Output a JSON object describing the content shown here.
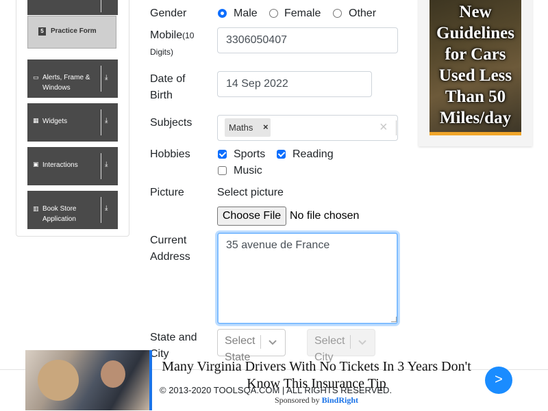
{
  "sidebar": {
    "groups": [
      {
        "label": "Alerts, Frame & Windows",
        "icon": "window-icon"
      },
      {
        "label": "Widgets",
        "icon": "widgets-icon"
      },
      {
        "label": "Interactions",
        "icon": "interactions-icon"
      },
      {
        "label": "Book Store Application",
        "icon": "bookstore-icon"
      }
    ],
    "active_subitem": {
      "label": "Practice Form",
      "icon": "html5-icon"
    },
    "arrow_glyph": "⤓"
  },
  "form": {
    "gender": {
      "label": "Gender",
      "options": [
        "Male",
        "Female",
        "Other"
      ],
      "selected": "Male"
    },
    "mobile": {
      "label": "Mobile",
      "hint": "(10 Digits)",
      "value": "3306050407"
    },
    "dob": {
      "label": "Date of Birth",
      "value": "14 Sep 2022"
    },
    "subjects": {
      "label": "Subjects",
      "chips": [
        "Maths"
      ],
      "clear_glyph": "×"
    },
    "hobbies": {
      "label": "Hobbies",
      "options": [
        "Sports",
        "Reading",
        "Music"
      ],
      "checked": [
        "Sports",
        "Reading"
      ]
    },
    "picture": {
      "label": "Picture",
      "select_text": "Select picture",
      "button": "Choose File",
      "status": "No file chosen"
    },
    "address": {
      "label": "Current Address",
      "value": "35 avenue de France"
    },
    "state_city": {
      "label": "State and City",
      "state_placeholder": "Select State",
      "city_placeholder": "Select City"
    }
  },
  "side_ad": {
    "headline": "New Guidelines for Cars Used Less Than 50 Miles/day"
  },
  "footer": {
    "copyright": "© 2013-2020 TOOLSQA.COM | ALL RIGHTS RESERVED."
  },
  "bottom_ad": {
    "headline": "Many Virginia Drivers With No Tickets In 3 Years Don't Know This Insurance Tip",
    "sponsored_by": "Sponsored by",
    "brand": "BindRight",
    "next_glyph": ">"
  },
  "colors": {
    "accent": "#0d6efd",
    "sidebar_group_bg": "#4a4a4a",
    "subitem_bg": "#cfcfcf",
    "ad_next_button": "#1a8cff",
    "ad_brand": "#1a73e8"
  }
}
